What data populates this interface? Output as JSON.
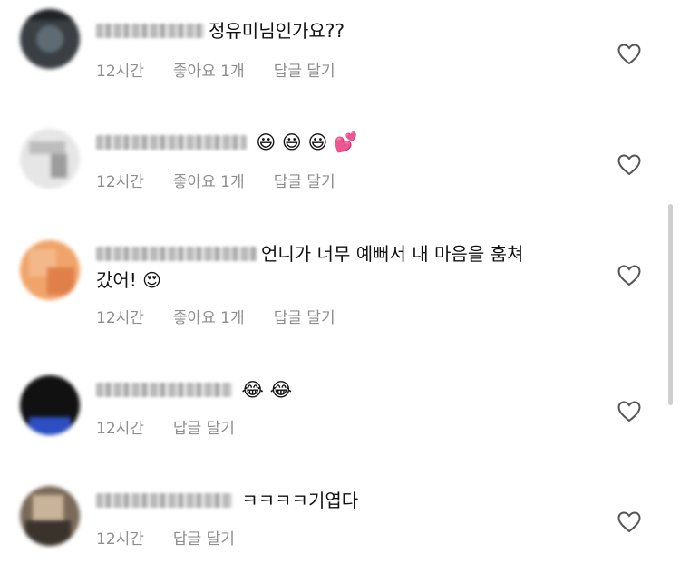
{
  "comments": [
    {
      "text": "정유미님인가요??",
      "emojis": "",
      "line2": "",
      "time": "12시간",
      "likes": "좋아요 1개",
      "reply": "답글 달기"
    },
    {
      "text": "",
      "emojis": "😃 😃 😃 💕",
      "line2": "",
      "time": "12시간",
      "likes": "좋아요 1개",
      "reply": "답글 달기"
    },
    {
      "text": "언니가 너무 예뻐서 내 마음을 훔쳐",
      "emojis": "",
      "line2": "갔어! 😍",
      "time": "12시간",
      "likes": "좋아요 1개",
      "reply": "답글 달기"
    },
    {
      "text": "",
      "emojis": "😂 😂",
      "line2": "",
      "time": "12시간",
      "likes": "",
      "reply": "답글 달기"
    },
    {
      "text": "ㅋㅋㅋㅋ기엽다",
      "emojis": "",
      "line2": "",
      "time": "12시간",
      "likes": "",
      "reply": "답글 달기"
    }
  ],
  "icons": {
    "like": "heart-outline-icon"
  }
}
